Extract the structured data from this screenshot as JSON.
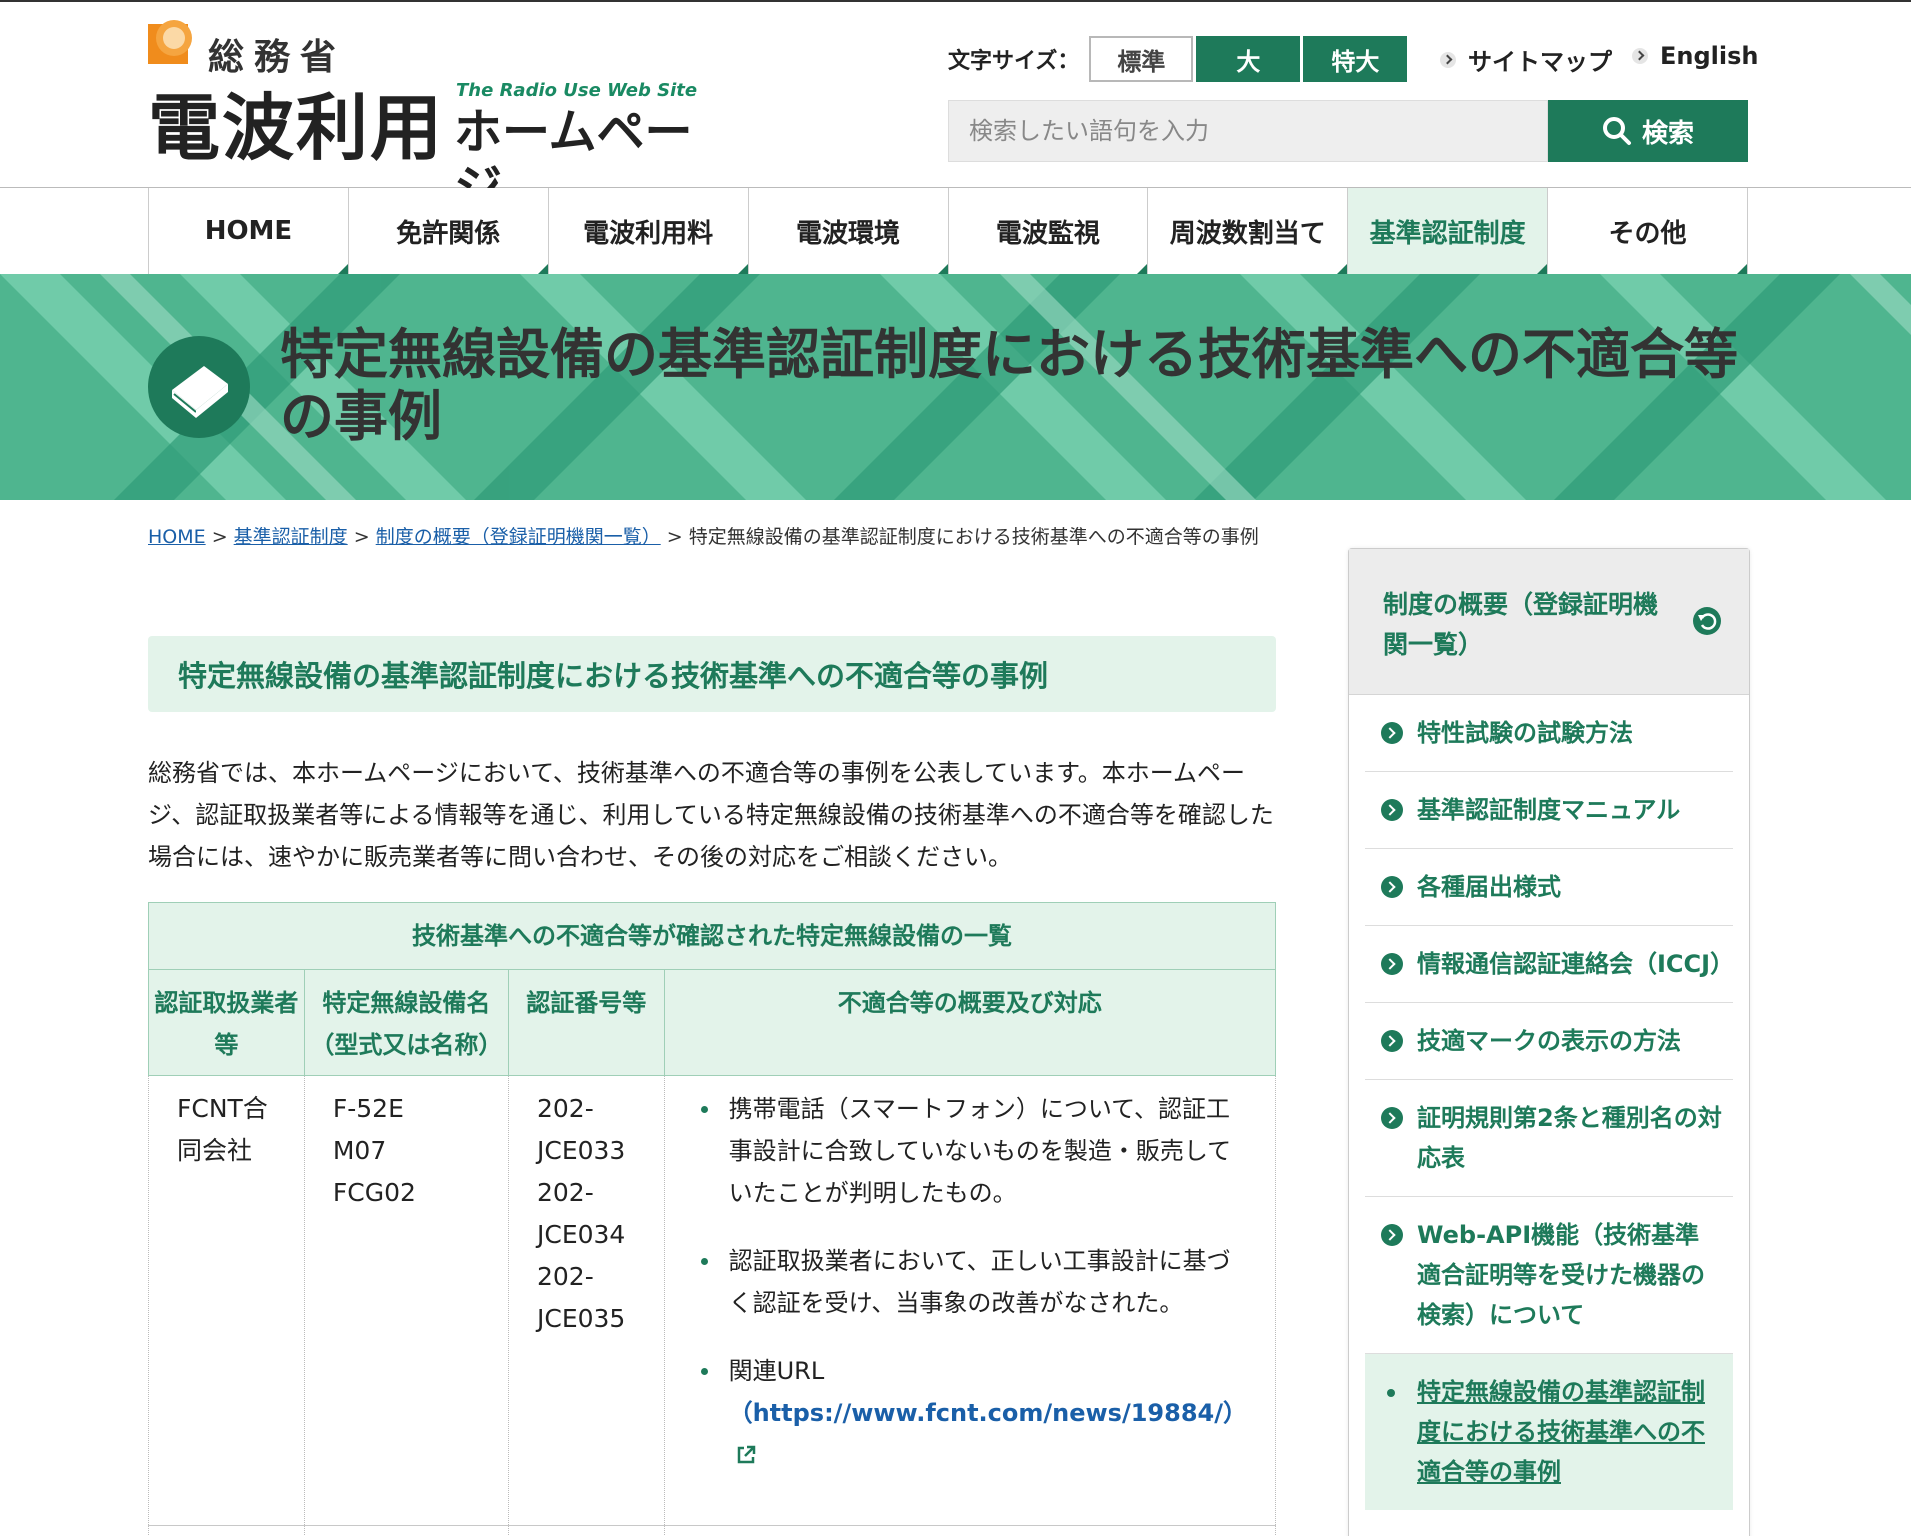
{
  "header": {
    "ministry": "総務省",
    "site_title": "電波利用",
    "site_en": "The Radio Use Web Site",
    "site_sub": "ホームページ",
    "font_size_label": "文字サイズ：",
    "font_sizes": [
      "標準",
      "大",
      "特大"
    ],
    "sitemap": "サイトマップ",
    "english": "English",
    "search_placeholder": "検索したい語句を入力",
    "search_button": "検索"
  },
  "nav": {
    "items": [
      "HOME",
      "免許関係",
      "電波利用料",
      "電波環境",
      "電波監視",
      "周波数割当て",
      "基準認証制度",
      "その他"
    ],
    "active_index": 6
  },
  "banner": {
    "title": "特定無線設備の基準認証制度における技術基準への不適合等の事例"
  },
  "breadcrumb": {
    "links": [
      "HOME",
      "基準認証制度",
      "制度の概要（登録証明機関一覧）"
    ],
    "current": "特定無線設備の基準認証制度における技術基準への不適合等の事例",
    "sep": ">"
  },
  "main": {
    "heading": "特定無線設備の基準認証制度における技術基準への不適合等の事例",
    "intro": "総務省では、本ホームページにおいて、技術基準への不適合等の事例を公表しています。本ホームページ、認証取扱業者等による情報等を通じ、利用している特定無線設備の技術基準への不適合等を確認した場合には、速やかに販売業者等に問い合わせ、その後の対応をご相談ください。",
    "table": {
      "caption": "技術基準への不適合等が確認された特定無線設備の一覧",
      "headers": [
        "認証取扱業者等",
        "特定無線設備名（型式又は名称）",
        "認証番号等",
        "不適合等の概要及び対応"
      ],
      "rows": [
        {
          "company": "FCNT合同会社",
          "devices": [
            "F-52E",
            "M07",
            "FCG02"
          ],
          "cert_numbers": [
            "202-JCE033",
            "202-JCE034",
            "202-JCE035"
          ],
          "summary": [
            "携帯電話（スマートフォン）について、認証工事設計に合致していないものを製造・販売していたことが判明したもの。",
            "認証取扱業者において、正しい工事設計に基づく認証を受け、当事象の改善がなされた。"
          ],
          "related_label": "関連URL",
          "related_url": "（https://www.fcnt.com/news/19884/）"
        }
      ]
    }
  },
  "sidebar": {
    "head": "制度の概要（登録証明機関一覧）",
    "items": [
      "特性試験の試験方法",
      "基準認証制度マニュアル",
      "各種届出様式",
      "情報通信認証連絡会（ICCJ）",
      "技適マークの表示の方法",
      "証明規則第2条と種別名の対応表",
      "Web-API機能（技術基準適合証明等を受けた機器の検索）について"
    ],
    "current": "特定無線設備の基準認証制度における技術基準への不適合等の事例"
  },
  "colors": {
    "accent": "#1e7a5a",
    "light": "#e3f3ea",
    "link": "#1a5fa8",
    "logo_orange": "#f08c1c"
  }
}
